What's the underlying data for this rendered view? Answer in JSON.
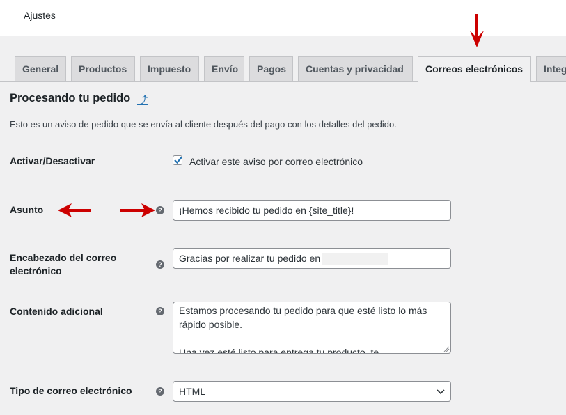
{
  "header": {
    "title": "Ajustes"
  },
  "tabs": [
    {
      "label": "General",
      "active": false
    },
    {
      "label": "Productos",
      "active": false
    },
    {
      "label": "Impuesto",
      "active": false
    },
    {
      "label": "Envío",
      "active": false
    },
    {
      "label": "Pagos",
      "active": false
    },
    {
      "label": "Cuentas y privacidad",
      "active": false
    },
    {
      "label": "Correos electrónicos",
      "active": true
    },
    {
      "label": "Integ",
      "active": false
    }
  ],
  "section": {
    "title": "Procesando tu pedido",
    "up_link_icon": "⤴",
    "description": "Esto es un aviso de pedido que se envía al cliente después del pago con los detalles del pedido."
  },
  "fields": {
    "enable": {
      "label": "Activar/Desactivar",
      "checkbox_label": "Activar este aviso por correo electrónico",
      "checked": true
    },
    "subject": {
      "label": "Asunto",
      "value": "¡Hemos recibido tu pedido en {site_title}!"
    },
    "heading": {
      "label": "Encabezado del correo electrónico",
      "value": "Gracias por realizar tu pedido en"
    },
    "additional": {
      "label": "Contenido adicional",
      "line1": "Estamos procesando tu pedido para que esté listo lo más",
      "line2": "rápido posible.",
      "line3": "Una vez esté listo para entrega tu producto, te"
    },
    "email_type": {
      "label": "Tipo de correo electrónico",
      "value": "HTML"
    }
  },
  "help_icon": "?",
  "colors": {
    "accent": "#2271b1",
    "annotation_arrow": "#cc0000",
    "background": "#f0f0f1"
  }
}
